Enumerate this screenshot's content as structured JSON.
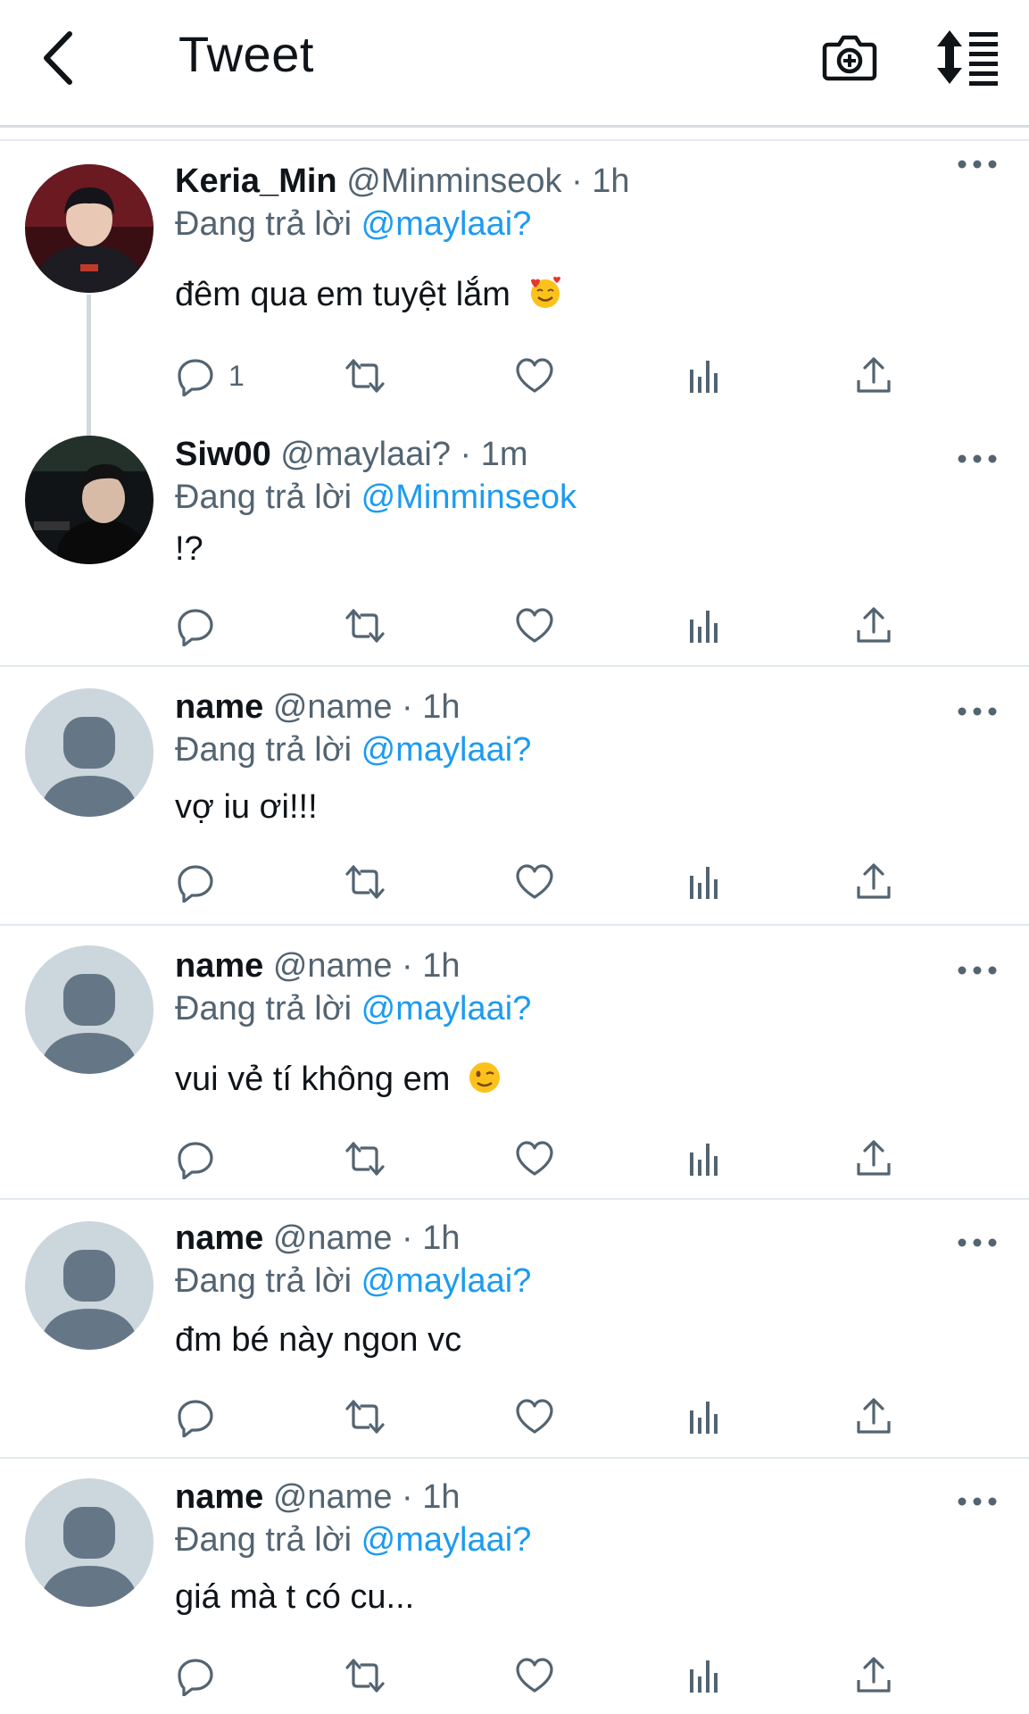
{
  "header": {
    "title": "Tweet",
    "back_icon": "chevron-left-icon",
    "camera_icon": "camera-plus-icon",
    "sort_icon": "sort-list-icon"
  },
  "tweets": [
    {
      "name": "Keria_Min",
      "handle": "@Minminseok",
      "dot": "·",
      "time": "1h",
      "reply_prefix": "Đang trả lời",
      "reply_to": "@maylaai?",
      "text": "đêm qua em tuyệt lắm",
      "emoji": "smiling-face-with-hearts",
      "reply_count": "1"
    },
    {
      "name": "Siw00",
      "handle": "@maylaai?",
      "dot": "·",
      "time": "1m",
      "reply_prefix": "Đang trả lời",
      "reply_to": "@Minminseok",
      "text": "!?",
      "reply_count": ""
    },
    {
      "name": "name",
      "handle": "@name",
      "dot": "·",
      "time": "1h",
      "reply_prefix": "Đang trả lời",
      "reply_to": "@maylaai?",
      "text": "vợ iu ơi!!!",
      "reply_count": ""
    },
    {
      "name": "name",
      "handle": "@name",
      "dot": "·",
      "time": "1h",
      "reply_prefix": "Đang trả lời",
      "reply_to": "@maylaai?",
      "text": "vui vẻ tí không em",
      "emoji": "winking-face",
      "reply_count": ""
    },
    {
      "name": "name",
      "handle": "@name",
      "dot": "·",
      "time": "1h",
      "reply_prefix": "Đang trả lời",
      "reply_to": "@maylaai?",
      "text": "đm bé này ngon vc",
      "reply_count": ""
    },
    {
      "name": "name",
      "handle": "@name",
      "dot": "·",
      "time": "1h",
      "reply_prefix": "Đang trả lời",
      "reply_to": "@maylaai?",
      "text": "giá mà t có cu...",
      "reply_count": ""
    }
  ],
  "colors": {
    "mention": "#1d9bf0",
    "secondary_text": "#536471",
    "primary_text": "#0f1419",
    "divider": "#e1e8ed"
  }
}
